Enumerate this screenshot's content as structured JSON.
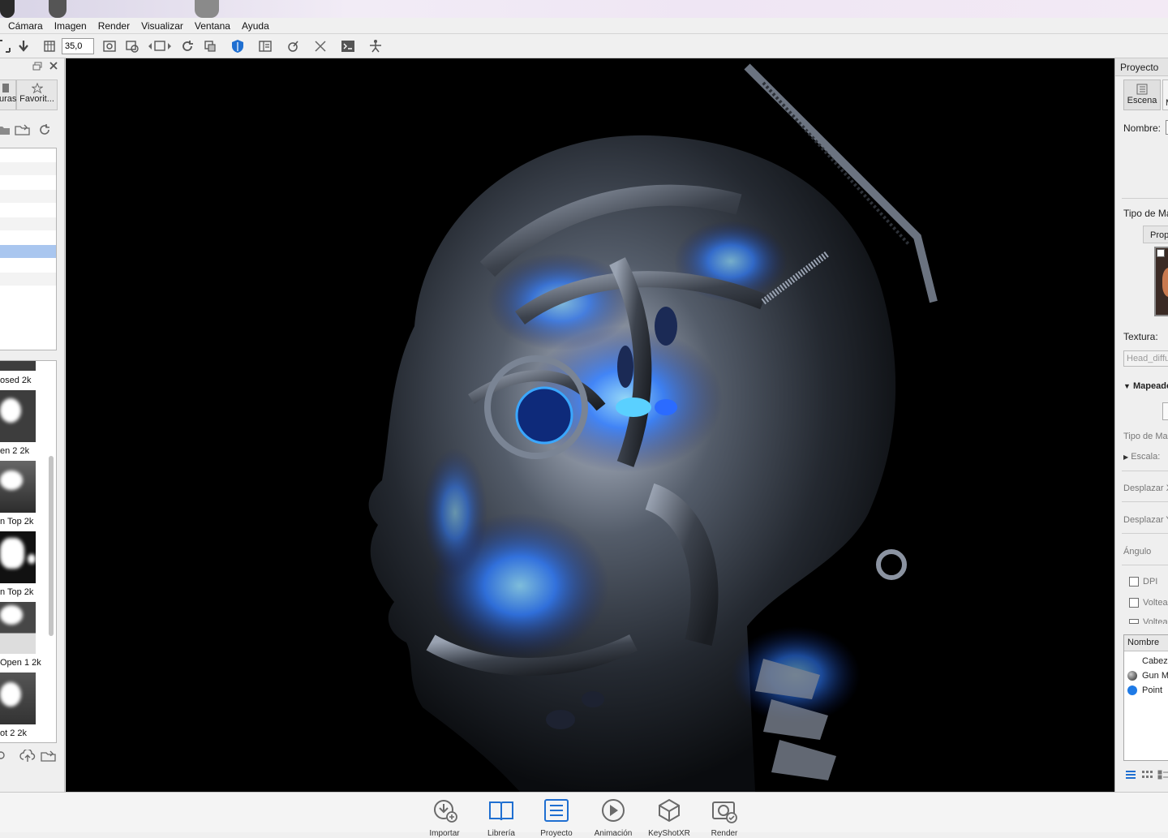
{
  "menu": [
    "Cámara",
    "Imagen",
    "Render",
    "Visualizar",
    "Ventana",
    "Ayuda"
  ],
  "toolbar": {
    "zoom_value": "35,0",
    "icons": [
      "fit-icon",
      "down-arrow-icon",
      "grid-icon",
      "screenshot-icon",
      "render-region-icon",
      "view-navigate-icon",
      "rotate-icon",
      "copy-icon",
      "shield-icon",
      "panel-layout-icon",
      "sun-icon",
      "expand-icon",
      "terminal-icon",
      "pose-icon"
    ]
  },
  "left_panel": {
    "tabs": [
      {
        "label": "uras",
        "icon": "texture-icon"
      },
      {
        "label": "Favorit...",
        "icon": "star-icon"
      }
    ],
    "thumbnails": [
      {
        "label": "osed 2k"
      },
      {
        "label": "en 2 2k"
      },
      {
        "label": "n Top 2k"
      },
      {
        "label": "n Top 2k"
      },
      {
        "label": "Open 1 2k"
      },
      {
        "label": "ot 2 2k"
      }
    ]
  },
  "right_panel": {
    "title": "Proyecto",
    "tab_scene": "Escena",
    "tab_second": "M",
    "nombre_label": "Nombre:",
    "tipo_material_label": "Tipo de Ma",
    "prop_tab": "Prop",
    "textura_label": "Textura:",
    "textura_value": "Head_diffu",
    "mapeado_label": "Mapeado",
    "tipo_mapeado_label": "Tipo de Ma",
    "escala_label": "Escala:",
    "desplazar_x_label": "Desplazar X",
    "desplazar_y_label": "Desplazar Y",
    "angulo_label": "Ángulo",
    "dpi_label": "DPI",
    "voltear_label": "Voltear",
    "voltear2_label": "Voltear",
    "table_header": "Nombre",
    "table_items": [
      {
        "label": "Cabez",
        "color": "#ffffff"
      },
      {
        "label": "Gun M",
        "color": "#555555"
      },
      {
        "label": "Point",
        "color": "#1e7ae6"
      }
    ]
  },
  "dock": {
    "buttons": [
      {
        "label": "Importar",
        "icon": "import-icon"
      },
      {
        "label": "Librería",
        "icon": "library-icon"
      },
      {
        "label": "Proyecto",
        "icon": "project-icon"
      },
      {
        "label": "Animación",
        "icon": "play-icon"
      },
      {
        "label": "KeyShotXR",
        "icon": "cube-icon"
      },
      {
        "label": "Render",
        "icon": "render-icon"
      }
    ]
  }
}
